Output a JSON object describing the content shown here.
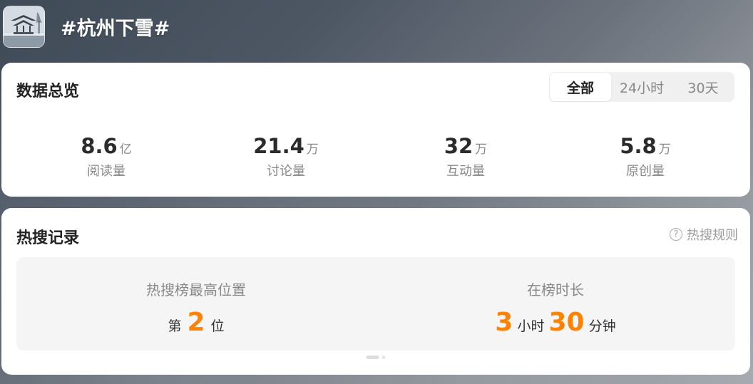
{
  "header": {
    "title": "#杭州下雪#",
    "avatar_icon": "snowy-pavilion-image"
  },
  "overview": {
    "title": "数据总览",
    "tabs": [
      {
        "label": "全部",
        "active": true
      },
      {
        "label": "24小时",
        "active": false
      },
      {
        "label": "30天",
        "active": false
      }
    ],
    "stats": [
      {
        "value": "8.6",
        "unit": "亿",
        "label": "阅读量"
      },
      {
        "value": "21.4",
        "unit": "万",
        "label": "讨论量"
      },
      {
        "value": "32",
        "unit": "万",
        "label": "互动量"
      },
      {
        "value": "5.8",
        "unit": "万",
        "label": "原创量"
      }
    ]
  },
  "hot_search": {
    "title": "热搜记录",
    "rules_label": "热搜规则",
    "rules_icon": "question-circle-icon",
    "top_position": {
      "label": "热搜榜最高位置",
      "prefix": "第",
      "value": "2",
      "suffix": "位"
    },
    "duration": {
      "label": "在榜时长",
      "hours": "3",
      "hours_unit": "小时",
      "minutes": "30",
      "minutes_unit": "分钟"
    },
    "pager": {
      "pages": 2,
      "current": 1
    }
  },
  "colors": {
    "accent": "#ff8200",
    "card_bg": "#ffffff",
    "panel_bg": "#f5f5f5",
    "muted_text": "#888888"
  }
}
